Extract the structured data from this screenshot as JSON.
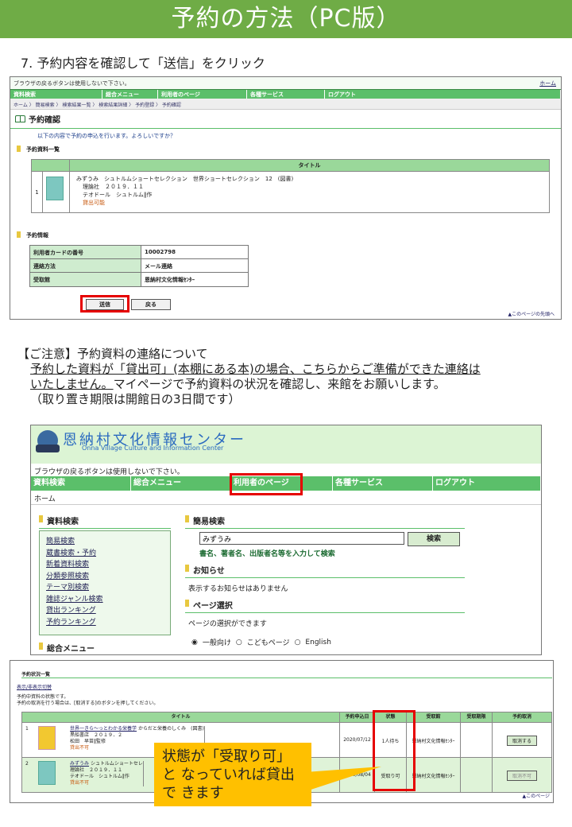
{
  "banner": "予約の方法（PC版）",
  "step": "7.  予約内容を確認して「送信」をクリック",
  "shot1": {
    "top_note": "ブラウザの戻るボタンは使用しないで下さい。",
    "home_link": "ホーム",
    "nav": [
      "資料検索",
      "総合メニュー",
      "利用者のページ",
      "各種サービス",
      "ログアウト"
    ],
    "breadcrumb": "ホーム 〉 簡易検索 〉 検索結果一覧 〉 検索結果詳細 〉 予約登録 〉 予約確認",
    "heading": "予約確認",
    "confirm_text": "以下の内容で予約の申込を行います。よろしいですか？",
    "list_title": "予約資料一覧",
    "col_title": "タイトル",
    "book": {
      "num": "1",
      "line1": "みずうみ　シュトルムショートセレクション　世界ショートセレクション　12　(図書)",
      "line2": "理論社　２０１９．１１",
      "line3": "テオドール　シュトルム‖作",
      "status": "貸出可能"
    },
    "info_title": "予約情報",
    "info_rows": [
      {
        "k": "利用者カードの番号",
        "v": "10002798"
      },
      {
        "k": "連絡方法",
        "v": "メール連絡"
      },
      {
        "k": "受取館",
        "v": "恩納村文化情報ｾﾝﾀｰ"
      }
    ],
    "send_btn": "送信",
    "back_btn": "戻る",
    "to_top": "▲このページの先頭へ"
  },
  "note": {
    "title": "【ご注意】予約資料の連絡について",
    "line1": "予約した資料が「貸出可」(本棚にある本)の場合、こちらからご準備ができた連絡は",
    "line2a": "いたしません。",
    "line2b": "マイページで予約資料の状況を確認し、来館をお願いします。",
    "line3": "（取り置き期限は開館日の3日間です）"
  },
  "shot2": {
    "site_title": "恩納村文化情報センター",
    "site_sub": "Onna Village Culture and Information Center",
    "top_note": "ブラウザの戻るボタンは使用しないで下さい。",
    "nav": [
      "資料検索",
      "総合メニュー",
      "利用者のページ",
      "各種サービス",
      "ログアウト"
    ],
    "home": "ホーム",
    "left_head": "資料検索",
    "links": [
      "簡易検索",
      "蔵書検索・予約",
      "新着資料検索",
      "分類参照検索",
      "テーマ別検索",
      "雑誌ジャンル検索",
      "貸出ランキング",
      "予約ランキング"
    ],
    "menu_head": "総合メニュー",
    "simple_head": "簡易検索",
    "search_value": "みずうみ",
    "search_btn": "検索",
    "search_hint": "書名、著者名、出版者名等を入力して検索",
    "news_head": "お知らせ",
    "news_text": "表示するお知らせはありません",
    "page_head": "ページ選択",
    "page_text": "ページの選択ができます",
    "radio1": "一般向け",
    "radio2": "こどもページ",
    "radio3": "English"
  },
  "shot3": {
    "title": "予約状況一覧",
    "toggle": "表示/非表示切替",
    "desc1": "予約中資料の状態です。",
    "desc2": "予約の取消を行う場合は、[取消する]のボタンを押してください。",
    "headers": [
      "タイトル",
      "予約申込日",
      "状態",
      "受取館",
      "受取期限",
      "予約取消"
    ],
    "rows": [
      {
        "num": "1",
        "line1": "世界一きら〜っとわかる栄養学",
        "line1b": "からだと栄養のしくみ　(図書)",
        "line2": "黒船書店　２０１９．２",
        "line3": "松田　早苗‖監修",
        "status_note": "貸出不可",
        "date": "2020/07/12",
        "state": "1人待ち",
        "place": "恩納村文化情報ｾﾝﾀｰ",
        "btn": "取消する"
      },
      {
        "num": "2",
        "line1": "みずうみ",
        "line1b": "シュトルムショートセレ",
        "line2": "理論社　２０１９．１１",
        "line3": "テオドール　シュトルム‖作",
        "status_note": "貸出不可",
        "date": "2020/08/04",
        "state": "受取り可",
        "place": "恩納村文化情報ｾﾝﾀｰ",
        "btn": "取消不可"
      }
    ],
    "to_top": "▲このページ"
  },
  "callout": "状態が「受取り可」と なっていれば貸出で きます"
}
